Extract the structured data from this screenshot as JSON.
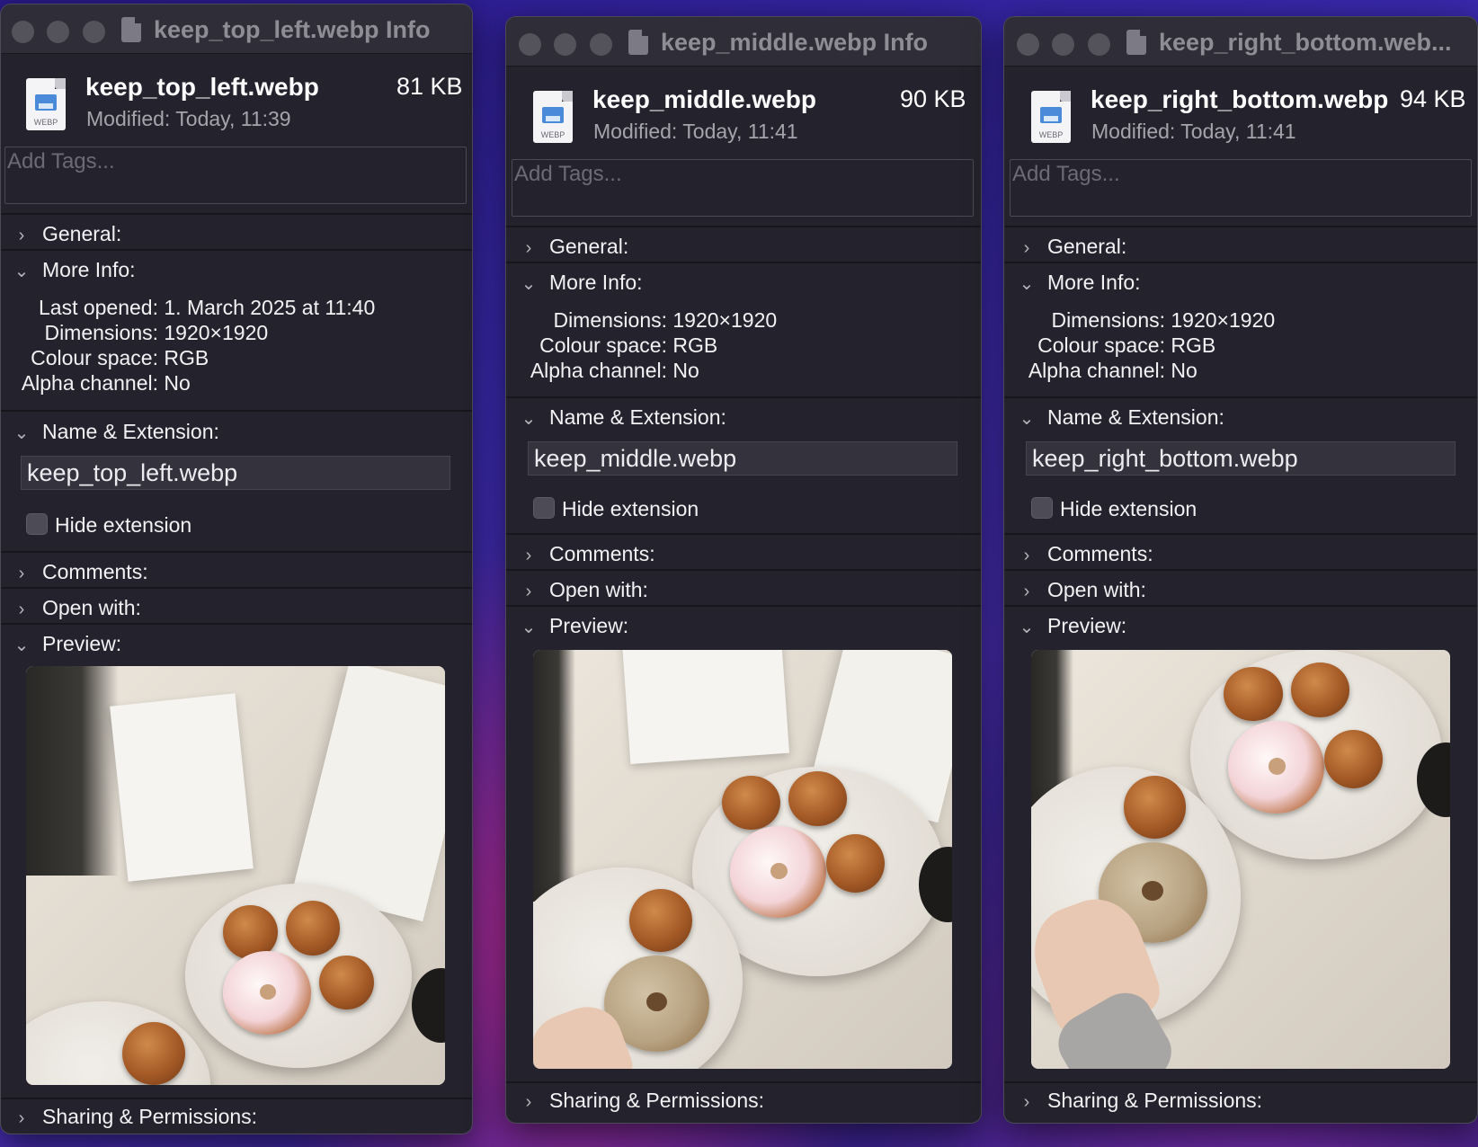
{
  "windows": [
    {
      "title": "keep_top_left.webp Info",
      "filename": "keep_top_left.webp",
      "size": "81 KB",
      "modified": "Modified:  Today, 11:39",
      "icon_label": "WEBP",
      "tags_placeholder": "Add Tags...",
      "sections": {
        "general": "General:",
        "more_info": "More Info:",
        "name_ext": "Name & Extension:",
        "comments": "Comments:",
        "open_with": "Open with:",
        "preview": "Preview:",
        "sharing": "Sharing & Permissions:"
      },
      "info": [
        {
          "key": "Last opened:",
          "value": "1. March 2025 at 11:40"
        },
        {
          "key": "Dimensions:",
          "value": "1920×1920"
        },
        {
          "key": "Colour space:",
          "value": "RGB"
        },
        {
          "key": "Alpha channel:",
          "value": "No"
        }
      ],
      "name_field": "keep_top_left.webp",
      "hide_extension": "Hide extension",
      "hide_extension_checked": false
    },
    {
      "title": "keep_middle.webp Info",
      "filename": "keep_middle.webp",
      "size": "90 KB",
      "modified": "Modified:  Today, 11:41",
      "icon_label": "WEBP",
      "tags_placeholder": "Add Tags...",
      "sections": {
        "general": "General:",
        "more_info": "More Info:",
        "name_ext": "Name & Extension:",
        "comments": "Comments:",
        "open_with": "Open with:",
        "preview": "Preview:",
        "sharing": "Sharing & Permissions:"
      },
      "info": [
        {
          "key": "Dimensions:",
          "value": "1920×1920"
        },
        {
          "key": "Colour space:",
          "value": "RGB"
        },
        {
          "key": "Alpha channel:",
          "value": "No"
        }
      ],
      "name_field": "keep_middle.webp",
      "hide_extension": "Hide extension",
      "hide_extension_checked": false
    },
    {
      "title": "keep_right_bottom.web...",
      "filename": "keep_right_bottom.webp",
      "size": "94 KB",
      "modified": "Modified:  Today, 11:41",
      "icon_label": "WEBP",
      "tags_placeholder": "Add Tags...",
      "sections": {
        "general": "General:",
        "more_info": "More Info:",
        "name_ext": "Name & Extension:",
        "comments": "Comments:",
        "open_with": "Open with:",
        "preview": "Preview:",
        "sharing": "Sharing & Permissions:"
      },
      "info": [
        {
          "key": "Dimensions:",
          "value": "1920×1920"
        },
        {
          "key": "Colour space:",
          "value": "RGB"
        },
        {
          "key": "Alpha channel:",
          "value": "No"
        }
      ],
      "name_field": "keep_right_bottom.webp",
      "hide_extension": "Hide extension",
      "hide_extension_checked": false
    }
  ],
  "icons": {
    "chevron_right": "›",
    "chevron_down": "⌄"
  }
}
